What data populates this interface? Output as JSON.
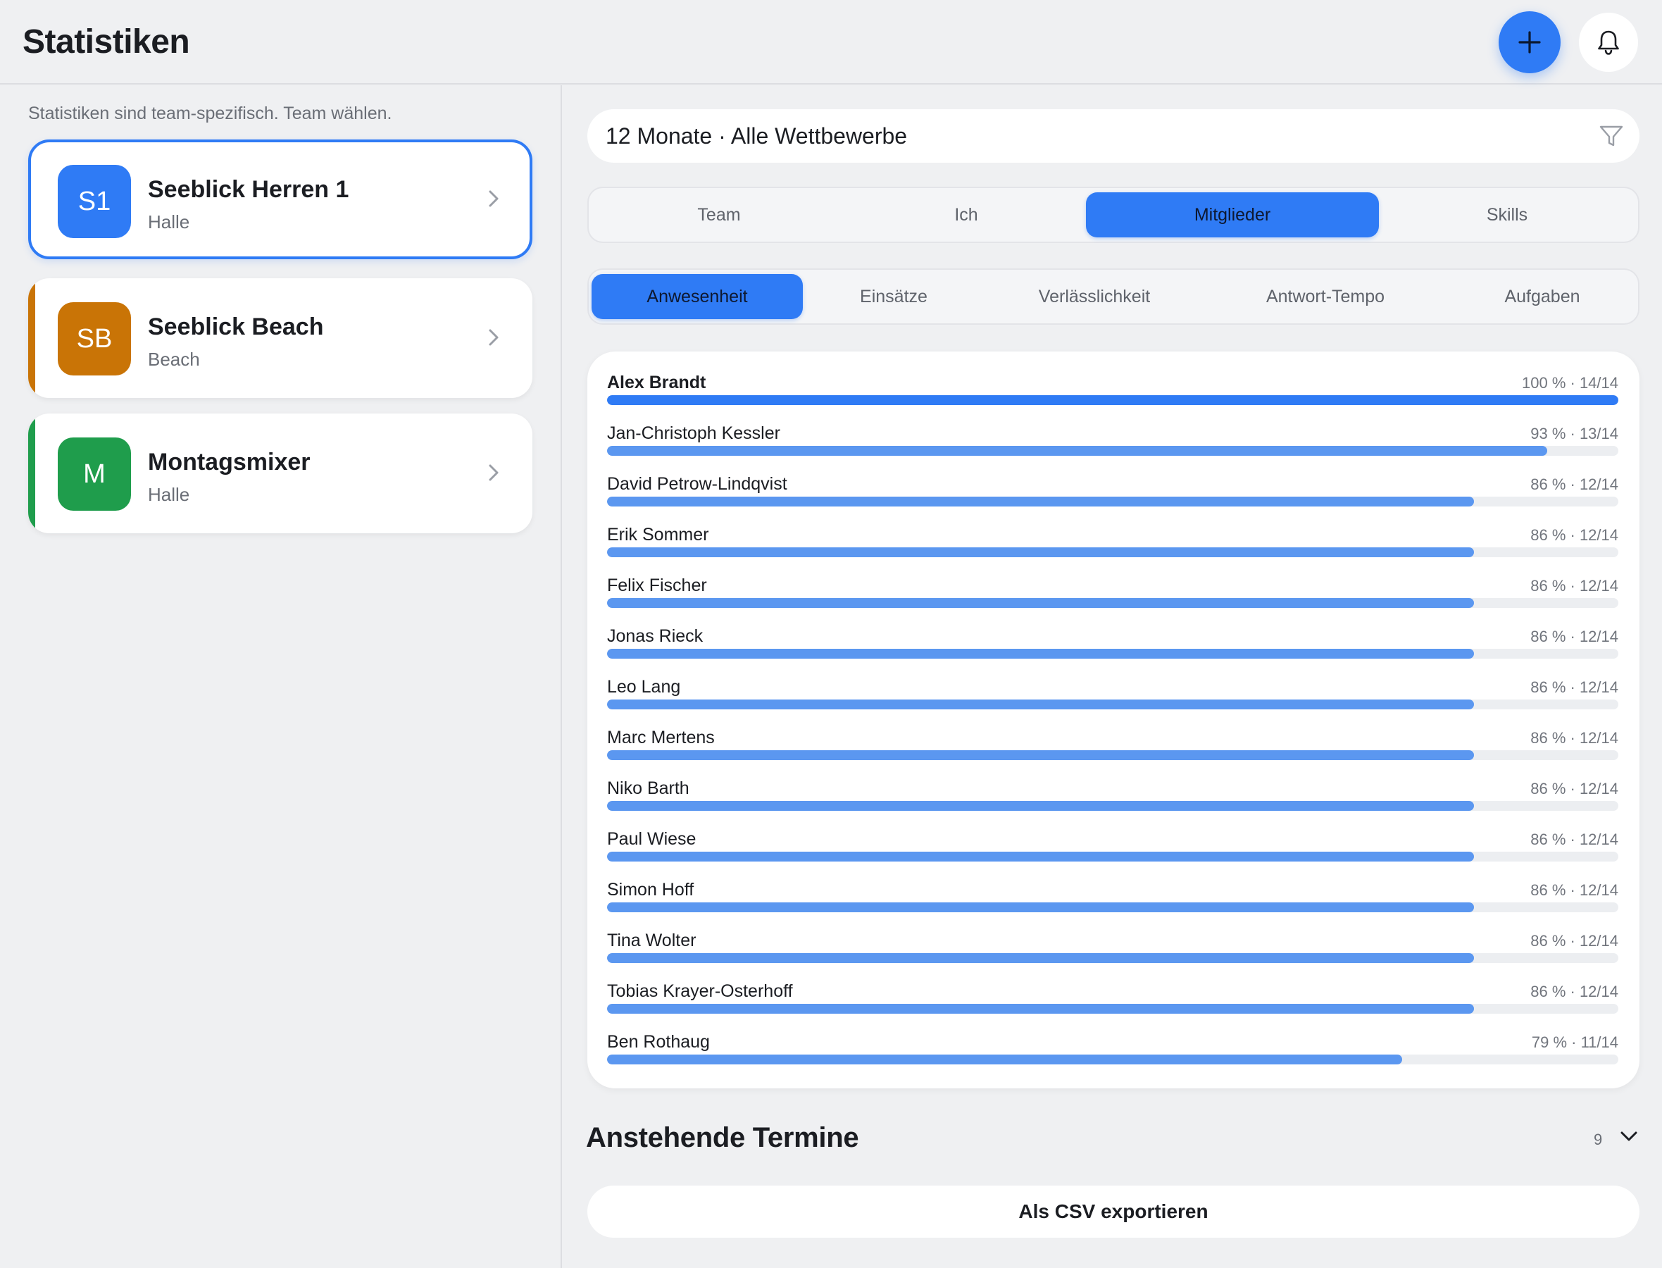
{
  "header": {
    "title": "Statistiken"
  },
  "sidebar": {
    "hint": "Statistiken sind team-spezifisch. Team wählen.",
    "teams": [
      {
        "initials": "S1",
        "name": "Seeblick Herren 1",
        "sub": "Halle",
        "color": "#2f7bf5",
        "selected": true
      },
      {
        "initials": "SB",
        "name": "Seeblick Beach",
        "sub": "Beach",
        "color": "#c97406",
        "selected": false
      },
      {
        "initials": "M",
        "name": "Montagsmixer",
        "sub": "Halle",
        "color": "#1f9d4c",
        "selected": false
      }
    ]
  },
  "filter": {
    "label": "12 Monate · Alle Wettbewerbe"
  },
  "tabs": [
    {
      "label": "Team",
      "active": false
    },
    {
      "label": "Ich",
      "active": false
    },
    {
      "label": "Mitglieder",
      "active": true
    },
    {
      "label": "Skills",
      "active": false
    }
  ],
  "subtabs": [
    {
      "label": "Anwesenheit",
      "active": true
    },
    {
      "label": "Einsätze",
      "active": false
    },
    {
      "label": "Verlässlichkeit",
      "active": false
    },
    {
      "label": "Antwort-Tempo",
      "active": false
    },
    {
      "label": "Aufgaben",
      "active": false
    }
  ],
  "members": [
    {
      "name": "Alex Brandt",
      "value": "100 % · 14/14",
      "fraction": 1.0
    },
    {
      "name": "Jan-Christoph Kessler",
      "value": "93 % · 13/14",
      "fraction": 0.93
    },
    {
      "name": "David Petrow-Lindqvist",
      "value": "86 % · 12/14",
      "fraction": 0.857
    },
    {
      "name": "Erik Sommer",
      "value": "86 % · 12/14",
      "fraction": 0.857
    },
    {
      "name": "Felix Fischer",
      "value": "86 % · 12/14",
      "fraction": 0.857
    },
    {
      "name": "Jonas Rieck",
      "value": "86 % · 12/14",
      "fraction": 0.857
    },
    {
      "name": "Leo Lang",
      "value": "86 % · 12/14",
      "fraction": 0.857
    },
    {
      "name": "Marc Mertens",
      "value": "86 % · 12/14",
      "fraction": 0.857
    },
    {
      "name": "Niko Barth",
      "value": "86 % · 12/14",
      "fraction": 0.857
    },
    {
      "name": "Paul Wiese",
      "value": "86 % · 12/14",
      "fraction": 0.857
    },
    {
      "name": "Simon Hoff",
      "value": "86 % · 12/14",
      "fraction": 0.857
    },
    {
      "name": "Tina Wolter",
      "value": "86 % · 12/14",
      "fraction": 0.857
    },
    {
      "name": "Tobias Krayer-Osterhoff",
      "value": "86 % · 12/14",
      "fraction": 0.857
    },
    {
      "name": "Ben Rothaug",
      "value": "79 % · 11/14",
      "fraction": 0.786
    }
  ],
  "upcoming": {
    "title": "Anstehende Termine",
    "count": "9"
  },
  "export": {
    "label": "Als CSV exportieren"
  },
  "icons": {
    "add": "plus-icon",
    "bell": "bell-icon",
    "filter": "filter-icon",
    "chevron": "chevron-right-icon",
    "expand": "chevron-down-icon"
  }
}
